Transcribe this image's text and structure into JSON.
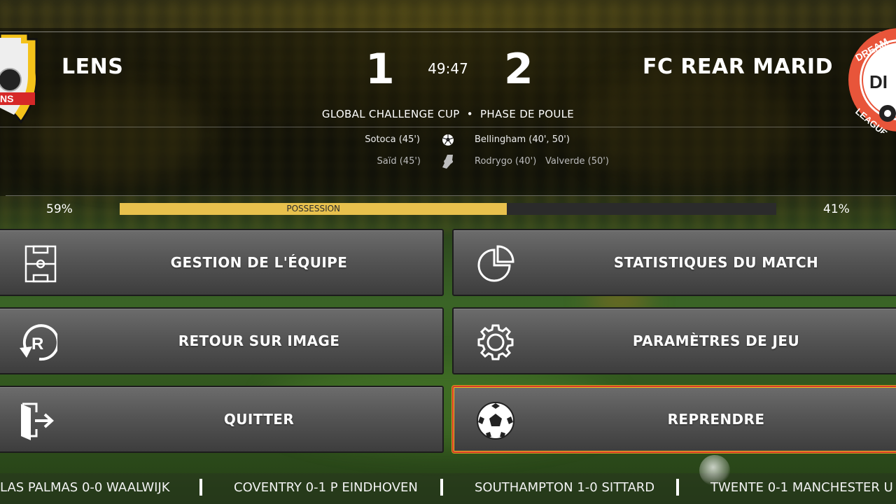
{
  "scoreboard": {
    "home_team": "LENS",
    "away_team": "FC REAR MARID",
    "home_score": "1",
    "away_score": "2",
    "clock": "49:47",
    "competition": "GLOBAL CHALLENGE CUP  •  PHASE DE POULE",
    "home_crest_text": "NS",
    "away_crest_text": "DREAM",
    "away_crest_sub": "LEAGUE",
    "away_crest_initials": "DI"
  },
  "events": {
    "home_goals": "Sotoca (45')",
    "away_goals": "Bellingham (40', 50')",
    "home_cards": "Saïd (45')",
    "away_cards_1": "Rodrygo (40')",
    "away_cards_2": "Valverde (50')",
    "goal_icon": "soccer-ball-icon",
    "card_icon": "boot-card-icon"
  },
  "possession": {
    "label": "POSSESSION",
    "home_pct_text": "59%",
    "away_pct_text": "41%",
    "home_value": 59,
    "fill_color": "#e8c14d"
  },
  "menu": {
    "team_management": "GESTION DE L'ÉQUIPE",
    "match_stats": "STATISTIQUES DU MATCH",
    "replay": "RETOUR SUR IMAGE",
    "game_settings": "PARAMÈTRES DE JEU",
    "quit": "QUITTER",
    "resume": "REPRENDRE",
    "selected": "resume",
    "selected_border_color": "#d93a2a"
  },
  "ticker": {
    "items": [
      "LAS PALMAS 0-0 WAALWIJK",
      "COVENTRY 0-1 P EINDHOVEN",
      "SOUTHAMPTON 1-0 SITTARD",
      "TWENTE 0-1 MANCHESTER U"
    ]
  }
}
